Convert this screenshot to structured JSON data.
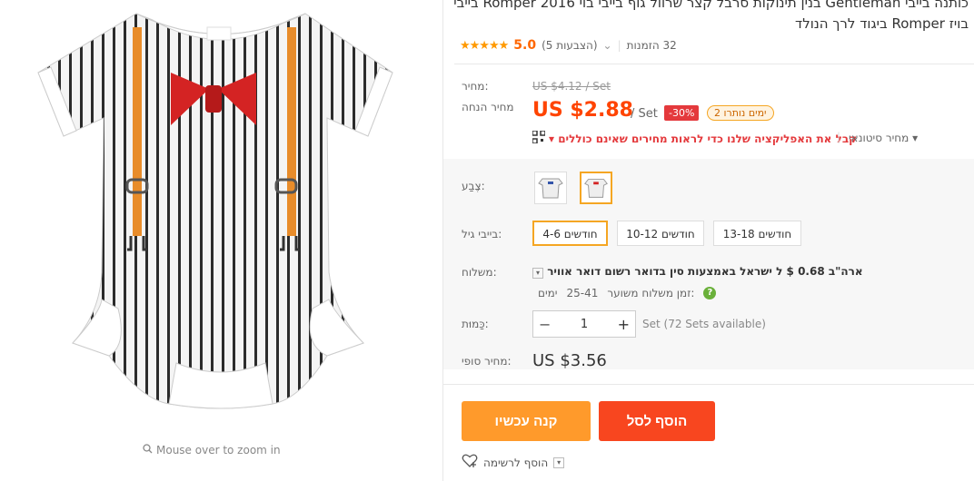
{
  "product": {
    "title": "כותנה בייבי Gentleman בנין תינוקות סרבל קצר שרוול גוף בייבי בוי Romper 2016 בייבי בויז Romper ביגוד לרך הנולד",
    "rating_stars": "★★★★★",
    "rating_score": "5.0",
    "rating_count": "(5 הצבעות)",
    "orders": "32 הזמנות"
  },
  "gallery": {
    "zoom_hint": "Mouse over to zoom in",
    "colors": {
      "stripe": "#2b2b2b",
      "suspender": "#e88c2a",
      "bow": "#d42323"
    }
  },
  "pricing": {
    "price_label": "מחיר:",
    "old_price": "US $4.12 / Set",
    "discount_label": "מחיר הנחה",
    "price": "US $2.88",
    "unit": "/ Set",
    "discount_badge": "-30%",
    "days_left": "ימים נותרו 2",
    "wholesale": "מחיר סיטונאי ▾",
    "app_promo": "קבל את האפליקציה שלנו כדי לראות מחירים שאינם כוללים ▾"
  },
  "options": {
    "color_label": "צֶבַע:",
    "size_label": "בייבי גיל:",
    "sizes": [
      "חודשים 4-6",
      "חודשים 10-12",
      "חודשים 13-18"
    ],
    "selected_size": 0
  },
  "shipping": {
    "label": "משלוח:",
    "method": "ארה\"ב 0.68 $ ל ישראל באמצעות סין בדואר רשום דואר אוויר",
    "time_label": "זמן משלוח משוער:",
    "time_value": "25-41",
    "time_unit": "ימים"
  },
  "quantity": {
    "label": "כַּמוּת:",
    "value": "1",
    "available": "Set (72 Sets available)"
  },
  "final_price": {
    "label": "מחיר סופי:",
    "value": "US $3.56"
  },
  "actions": {
    "buy_now": "קנה עכשיו",
    "add_to_cart": "הוסף לסל",
    "wishlist": "הוסף לרשימה"
  }
}
